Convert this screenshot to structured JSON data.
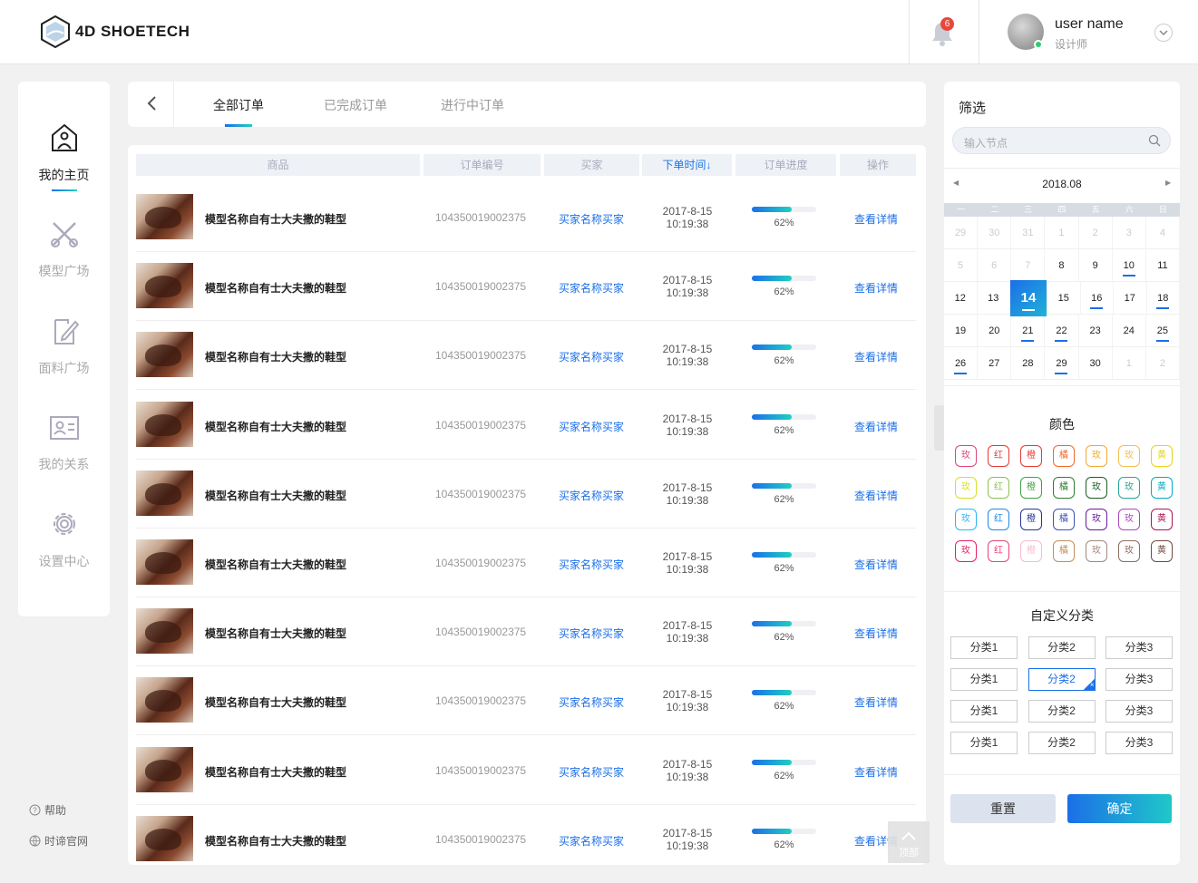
{
  "header": {
    "logo_text": "4D SHOETECH",
    "notification_count": "6",
    "user_name": "user name",
    "user_role": "设计师"
  },
  "sidebar": {
    "items": [
      {
        "label": "我的主页",
        "icon": "home-icon",
        "active": true
      },
      {
        "label": "模型广场",
        "icon": "scissors-icon",
        "active": false
      },
      {
        "label": "面料广场",
        "icon": "edit-icon",
        "active": false
      },
      {
        "label": "我的关系",
        "icon": "contact-card-icon",
        "active": false
      },
      {
        "label": "设置中心",
        "icon": "gear-icon",
        "active": false
      }
    ],
    "footer": [
      {
        "label": "帮助",
        "icon": "help-icon"
      },
      {
        "label": "时谛官网",
        "icon": "globe-icon"
      }
    ]
  },
  "tabs": [
    "全部订单",
    "已完成订单",
    "进行中订单"
  ],
  "table": {
    "headers": [
      "商品",
      "订单编号",
      "买家",
      "下单时间↓",
      "订单进度",
      "操作"
    ],
    "rows": [
      {
        "name": "模型名称自有士大夫撒的鞋型",
        "number": "104350019002375",
        "buyer": "买家名称买家",
        "date": "2017-8-15",
        "time": "10:19:38",
        "progress": 62,
        "progress_label": "62%",
        "action": "查看详情"
      },
      {
        "name": "模型名称自有士大夫撒的鞋型",
        "number": "104350019002375",
        "buyer": "买家名称买家",
        "date": "2017-8-15",
        "time": "10:19:38",
        "progress": 62,
        "progress_label": "62%",
        "action": "查看详情"
      },
      {
        "name": "模型名称自有士大夫撒的鞋型",
        "number": "104350019002375",
        "buyer": "买家名称买家",
        "date": "2017-8-15",
        "time": "10:19:38",
        "progress": 62,
        "progress_label": "62%",
        "action": "查看详情"
      },
      {
        "name": "模型名称自有士大夫撒的鞋型",
        "number": "104350019002375",
        "buyer": "买家名称买家",
        "date": "2017-8-15",
        "time": "10:19:38",
        "progress": 62,
        "progress_label": "62%",
        "action": "查看详情"
      },
      {
        "name": "模型名称自有士大夫撒的鞋型",
        "number": "104350019002375",
        "buyer": "买家名称买家",
        "date": "2017-8-15",
        "time": "10:19:38",
        "progress": 62,
        "progress_label": "62%",
        "action": "查看详情"
      },
      {
        "name": "模型名称自有士大夫撒的鞋型",
        "number": "104350019002375",
        "buyer": "买家名称买家",
        "date": "2017-8-15",
        "time": "10:19:38",
        "progress": 62,
        "progress_label": "62%",
        "action": "查看详情"
      },
      {
        "name": "模型名称自有士大夫撒的鞋型",
        "number": "104350019002375",
        "buyer": "买家名称买家",
        "date": "2017-8-15",
        "time": "10:19:38",
        "progress": 62,
        "progress_label": "62%",
        "action": "查看详情"
      },
      {
        "name": "模型名称自有士大夫撒的鞋型",
        "number": "104350019002375",
        "buyer": "买家名称买家",
        "date": "2017-8-15",
        "time": "10:19:38",
        "progress": 62,
        "progress_label": "62%",
        "action": "查看详情"
      },
      {
        "name": "模型名称自有士大夫撒的鞋型",
        "number": "104350019002375",
        "buyer": "买家名称买家",
        "date": "2017-8-15",
        "time": "10:19:38",
        "progress": 62,
        "progress_label": "62%",
        "action": "查看详情"
      },
      {
        "name": "模型名称自有士大夫撒的鞋型",
        "number": "104350019002375",
        "buyer": "买家名称买家",
        "date": "2017-8-15",
        "time": "10:19:38",
        "progress": 62,
        "progress_label": "62%",
        "action": "查看详情"
      }
    ]
  },
  "to_top_label": "顶部",
  "filter": {
    "title": "筛选",
    "search_placeholder": "输入节点",
    "calendar": {
      "month": "2018.08",
      "weekdays": [
        "一",
        "二",
        "三",
        "四",
        "五",
        "六",
        "日"
      ],
      "weeks": [
        [
          {
            "d": "29",
            "dim": true
          },
          {
            "d": "30",
            "dim": true
          },
          {
            "d": "31",
            "dim": true
          },
          {
            "d": "1",
            "dim": true
          },
          {
            "d": "2",
            "dim": true
          },
          {
            "d": "3",
            "dim": true
          },
          {
            "d": "4",
            "dim": true
          }
        ],
        [
          {
            "d": "5",
            "dim": true
          },
          {
            "d": "6",
            "dim": true
          },
          {
            "d": "7",
            "dim": true
          },
          {
            "d": "8"
          },
          {
            "d": "9"
          },
          {
            "d": "10",
            "mark": true
          },
          {
            "d": "11"
          }
        ],
        [
          {
            "d": "12"
          },
          {
            "d": "13"
          },
          {
            "d": "14",
            "selected": true,
            "mark": true
          },
          {
            "d": "15"
          },
          {
            "d": "16",
            "mark": true
          },
          {
            "d": "17"
          },
          {
            "d": "18",
            "mark": true
          }
        ],
        [
          {
            "d": "19"
          },
          {
            "d": "20"
          },
          {
            "d": "21",
            "mark": true
          },
          {
            "d": "22",
            "mark": true
          },
          {
            "d": "23"
          },
          {
            "d": "24"
          },
          {
            "d": "25",
            "mark": true
          }
        ],
        [
          {
            "d": "26",
            "mark": true
          },
          {
            "d": "27"
          },
          {
            "d": "28"
          },
          {
            "d": "29",
            "mark": true
          },
          {
            "d": "30"
          },
          {
            "d": "1",
            "dim": true
          },
          {
            "d": "2",
            "dim": true
          }
        ]
      ]
    },
    "color_title": "颜色",
    "colors": [
      [
        {
          "t": "玫",
          "c": "#e0457b"
        },
        {
          "t": "红",
          "c": "#e53935"
        },
        {
          "t": "橙",
          "c": "#e53935"
        },
        {
          "t": "橘",
          "c": "#f06a2a"
        },
        {
          "t": "玫",
          "c": "#f0a830"
        },
        {
          "t": "玫",
          "c": "#f2c14e"
        },
        {
          "t": "黄",
          "c": "#e8d21a"
        }
      ],
      [
        {
          "t": "玫",
          "c": "#d8e022"
        },
        {
          "t": "红",
          "c": "#8bc34a"
        },
        {
          "t": "橙",
          "c": "#43a047"
        },
        {
          "t": "橘",
          "c": "#2e7d32"
        },
        {
          "t": "玫",
          "c": "#1b5e20"
        },
        {
          "t": "玫",
          "c": "#26a69a"
        },
        {
          "t": "黄",
          "c": "#00acc1"
        }
      ],
      [
        {
          "t": "玫",
          "c": "#29b6f6"
        },
        {
          "t": "红",
          "c": "#1e88e5"
        },
        {
          "t": "橙",
          "c": "#283593"
        },
        {
          "t": "橘",
          "c": "#3f51b5"
        },
        {
          "t": "玫",
          "c": "#6a1b9a"
        },
        {
          "t": "玫",
          "c": "#ab47bc"
        },
        {
          "t": "黄",
          "c": "#ad1457"
        }
      ],
      [
        {
          "t": "玫",
          "c": "#e91e63"
        },
        {
          "t": "红",
          "c": "#ec407a"
        },
        {
          "t": "橙",
          "c": "#f8bbd0"
        },
        {
          "t": "橘",
          "c": "#c28e5c"
        },
        {
          "t": "玫",
          "c": "#a1887f"
        },
        {
          "t": "玫",
          "c": "#8d6e63"
        },
        {
          "t": "黄",
          "c": "#6d4c41"
        }
      ]
    ],
    "category_title": "自定义分类",
    "categories": [
      [
        {
          "t": "分类1"
        },
        {
          "t": "分类2"
        },
        {
          "t": "分类3"
        }
      ],
      [
        {
          "t": "分类1"
        },
        {
          "t": "分类2",
          "selected": true
        },
        {
          "t": "分类3"
        }
      ],
      [
        {
          "t": "分类1"
        },
        {
          "t": "分类2"
        },
        {
          "t": "分类3"
        }
      ],
      [
        {
          "t": "分类1"
        },
        {
          "t": "分类2"
        },
        {
          "t": "分类3"
        }
      ]
    ],
    "reset_label": "重置",
    "confirm_label": "确定"
  }
}
